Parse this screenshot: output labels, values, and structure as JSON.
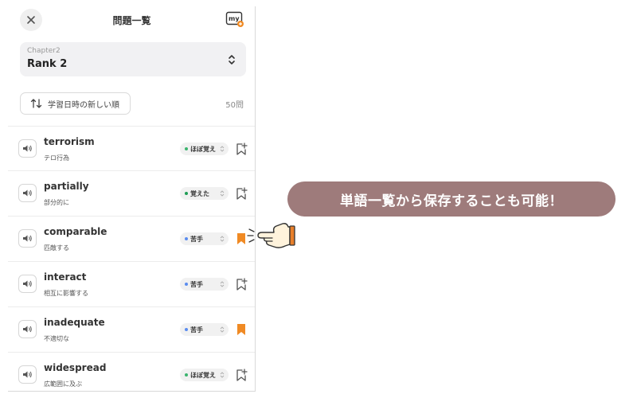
{
  "header": {
    "title": "問題一覧",
    "close_icon": "close-icon",
    "my_icon": "my-list-icon"
  },
  "chapter": {
    "label": "Chapter2",
    "value": "Rank 2"
  },
  "sort": {
    "label": "学習日時の新しい順",
    "count": "50問"
  },
  "words": [
    {
      "word": "terrorism",
      "meaning": "テロ行為",
      "status": "ほぼ覚え",
      "status_color": "#3bb46e",
      "bookmarked": false
    },
    {
      "word": "partially",
      "meaning": "部分的に",
      "status": "覚えた",
      "status_color": "#1f9d55",
      "bookmarked": false
    },
    {
      "word": "comparable",
      "meaning": "匹敵する",
      "status": "苦手",
      "status_color": "#5b8def",
      "bookmarked": true
    },
    {
      "word": "interact",
      "meaning": "相互に影響する",
      "status": "苦手",
      "status_color": "#5b8def",
      "bookmarked": false
    },
    {
      "word": "inadequate",
      "meaning": "不適切な",
      "status": "苦手",
      "status_color": "#5b8def",
      "bookmarked": true
    },
    {
      "word": "widespread",
      "meaning": "広範囲に及ぶ",
      "status": "ほぼ覚え",
      "status_color": "#3bb46e",
      "bookmarked": false
    }
  ],
  "callout": {
    "text": "単語一覧から保存することも可能！",
    "color": "#9e7b7b"
  },
  "colors": {
    "bookmark_active": "#f08a24",
    "bookmark_inactive": "#555555",
    "hand_outline": "#333333",
    "hand_fill": "#fff3dc",
    "cuff": "#e87f2a"
  }
}
